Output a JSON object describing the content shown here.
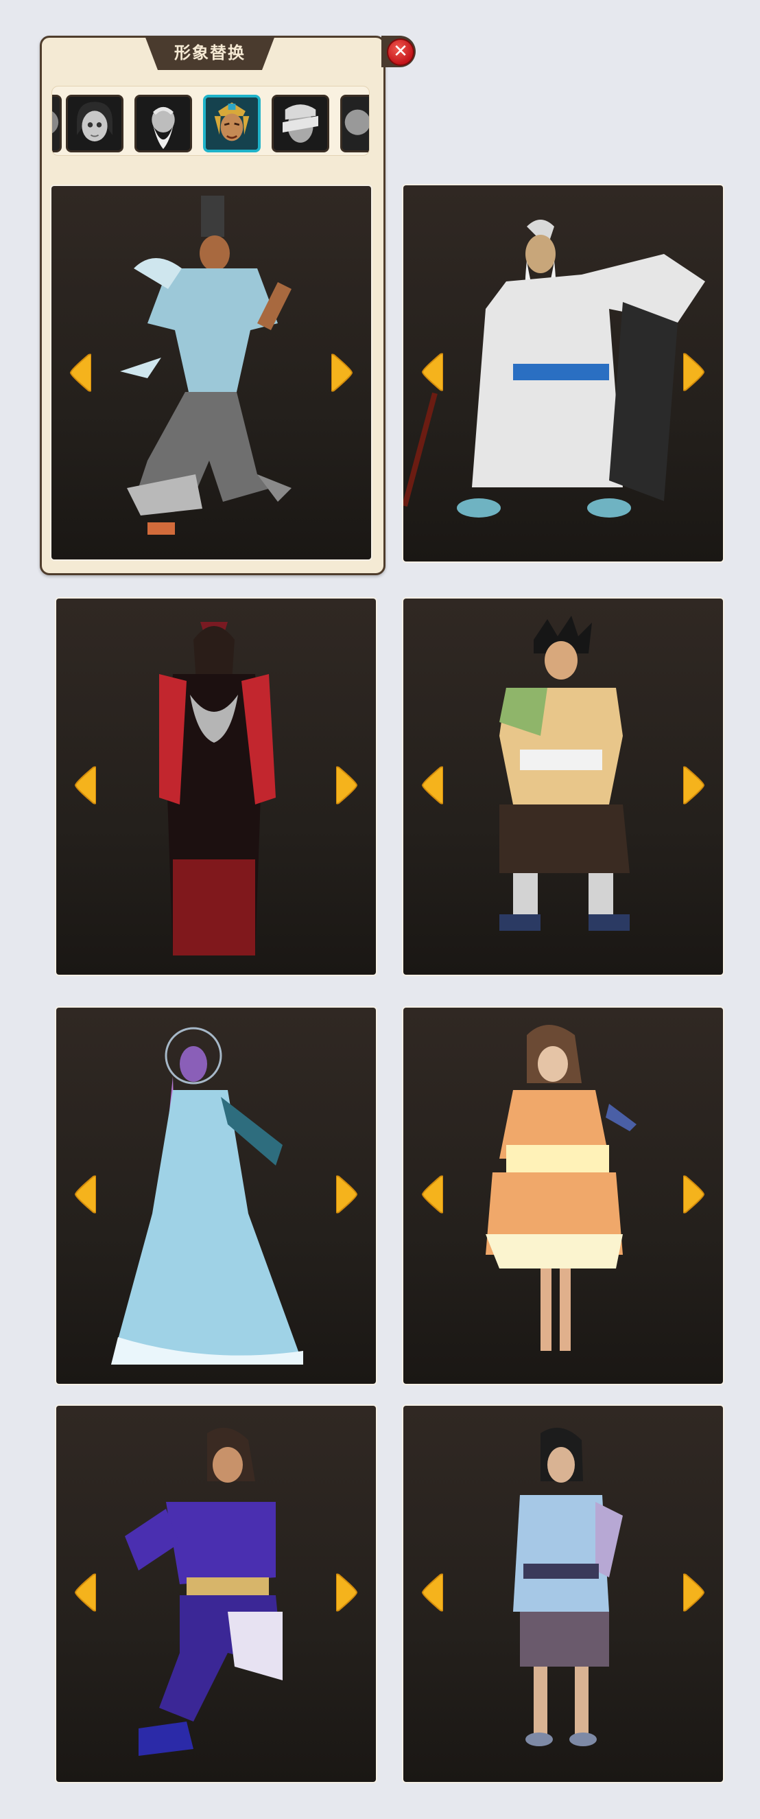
{
  "dialog": {
    "title": "形象替换",
    "close_icon": "close-icon",
    "accent_color": "#1fb3c9"
  },
  "thumbnails": [
    {
      "name": "girl-portrait",
      "active": false
    },
    {
      "name": "old-sage-portrait",
      "active": false
    },
    {
      "name": "warrior-portrait",
      "active": true
    },
    {
      "name": "masked-portrait",
      "active": false
    }
  ],
  "cards": [
    {
      "name": "scholar-warrior",
      "robe": "#9cc8d8",
      "trim": "#6f6f6f"
    },
    {
      "name": "white-bearded-sage",
      "robe": "#e6e6e6",
      "trim": "#2a6fc2"
    },
    {
      "name": "red-black-robed-woman",
      "robe": "#1c1010",
      "trim": "#c2262e"
    },
    {
      "name": "spiky-haired-youth",
      "robe": "#e8c68a",
      "trim": "#2b3a63"
    },
    {
      "name": "headdress-dancer",
      "robe": "#9fd2e6",
      "trim": "#b87ad6"
    },
    {
      "name": "orange-dress-girl",
      "robe": "#f0a86a",
      "trim": "#fff2b8"
    },
    {
      "name": "purple-martial-artist",
      "robe": "#4a2fb0",
      "trim": "#e7e2f2"
    },
    {
      "name": "blue-shirt-villager",
      "robe": "#a6c8e6",
      "trim": "#6a5a6c"
    }
  ]
}
